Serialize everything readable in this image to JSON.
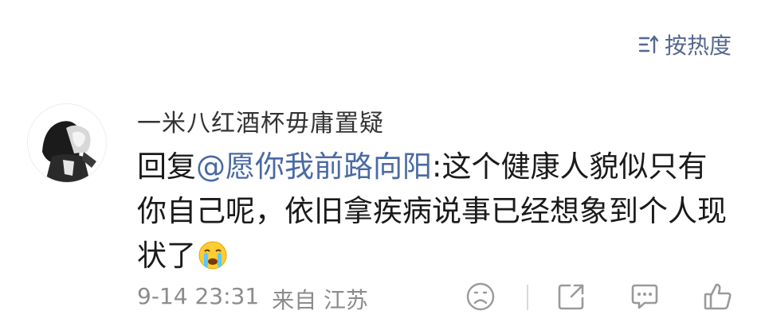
{
  "sort": {
    "label": "按热度",
    "icon": "sort-icon"
  },
  "comment": {
    "username": "一米八红酒杯毋庸置疑",
    "reply_prefix": "回复",
    "mention": "@愿你我前路向阳",
    "text": ":这个健康人貌似只有你自己呢，依旧拿疾病说事已经想象到个人现状了",
    "emoji": "crying-face-emoji",
    "time": "9-14 23:31",
    "location": "来自 江苏"
  },
  "actions": [
    {
      "name": "dislike-icon"
    },
    {
      "name": "share-icon"
    },
    {
      "name": "comment-icon"
    },
    {
      "name": "like-icon"
    }
  ],
  "colors": {
    "link": "#4a6aa3",
    "meta": "#8c8c8c",
    "icon": "#9a9a9a"
  }
}
